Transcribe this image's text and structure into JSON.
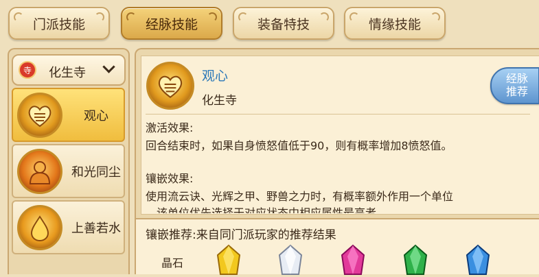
{
  "tabs": [
    {
      "label": "门派技能",
      "active": false
    },
    {
      "label": "经脉技能",
      "active": true
    },
    {
      "label": "装备特技",
      "active": false
    },
    {
      "label": "情缘技能",
      "active": false
    }
  ],
  "school": {
    "name": "化生寺",
    "emblem_char": "寺"
  },
  "skills": [
    {
      "label": "观心",
      "selected": true
    },
    {
      "label": "和光同尘",
      "selected": false
    },
    {
      "label": "上善若水",
      "selected": false
    }
  ],
  "detail": {
    "title": "观心",
    "subtitle": "化生寺",
    "recommend_badge": "经脉推荐",
    "activate_heading": "激活效果:",
    "activate_text": "回合结束时，如果自身愤怒值低于90，则有概率增加8愤怒值。",
    "inlay_heading": "镶嵌效果:",
    "inlay_text_1": "使用流云诀、光辉之甲、野兽之力时，有概率额外作用一个单位",
    "inlay_text_2": "，该单位优先选择于对应状态中相应属性最高者。"
  },
  "inlay_recommend": {
    "title": "镶嵌推荐:来自同门派玩家的推荐结果",
    "row_label": "晶石",
    "gem_colors": [
      "#f2c81e",
      "#e7ecf4",
      "#e23a9a",
      "#2fb14a",
      "#3a8fe0"
    ]
  },
  "colors": {
    "title_blue": "#2b78b8",
    "active_tab": "#e7b85a",
    "badge_blue": "#5e95cf"
  }
}
